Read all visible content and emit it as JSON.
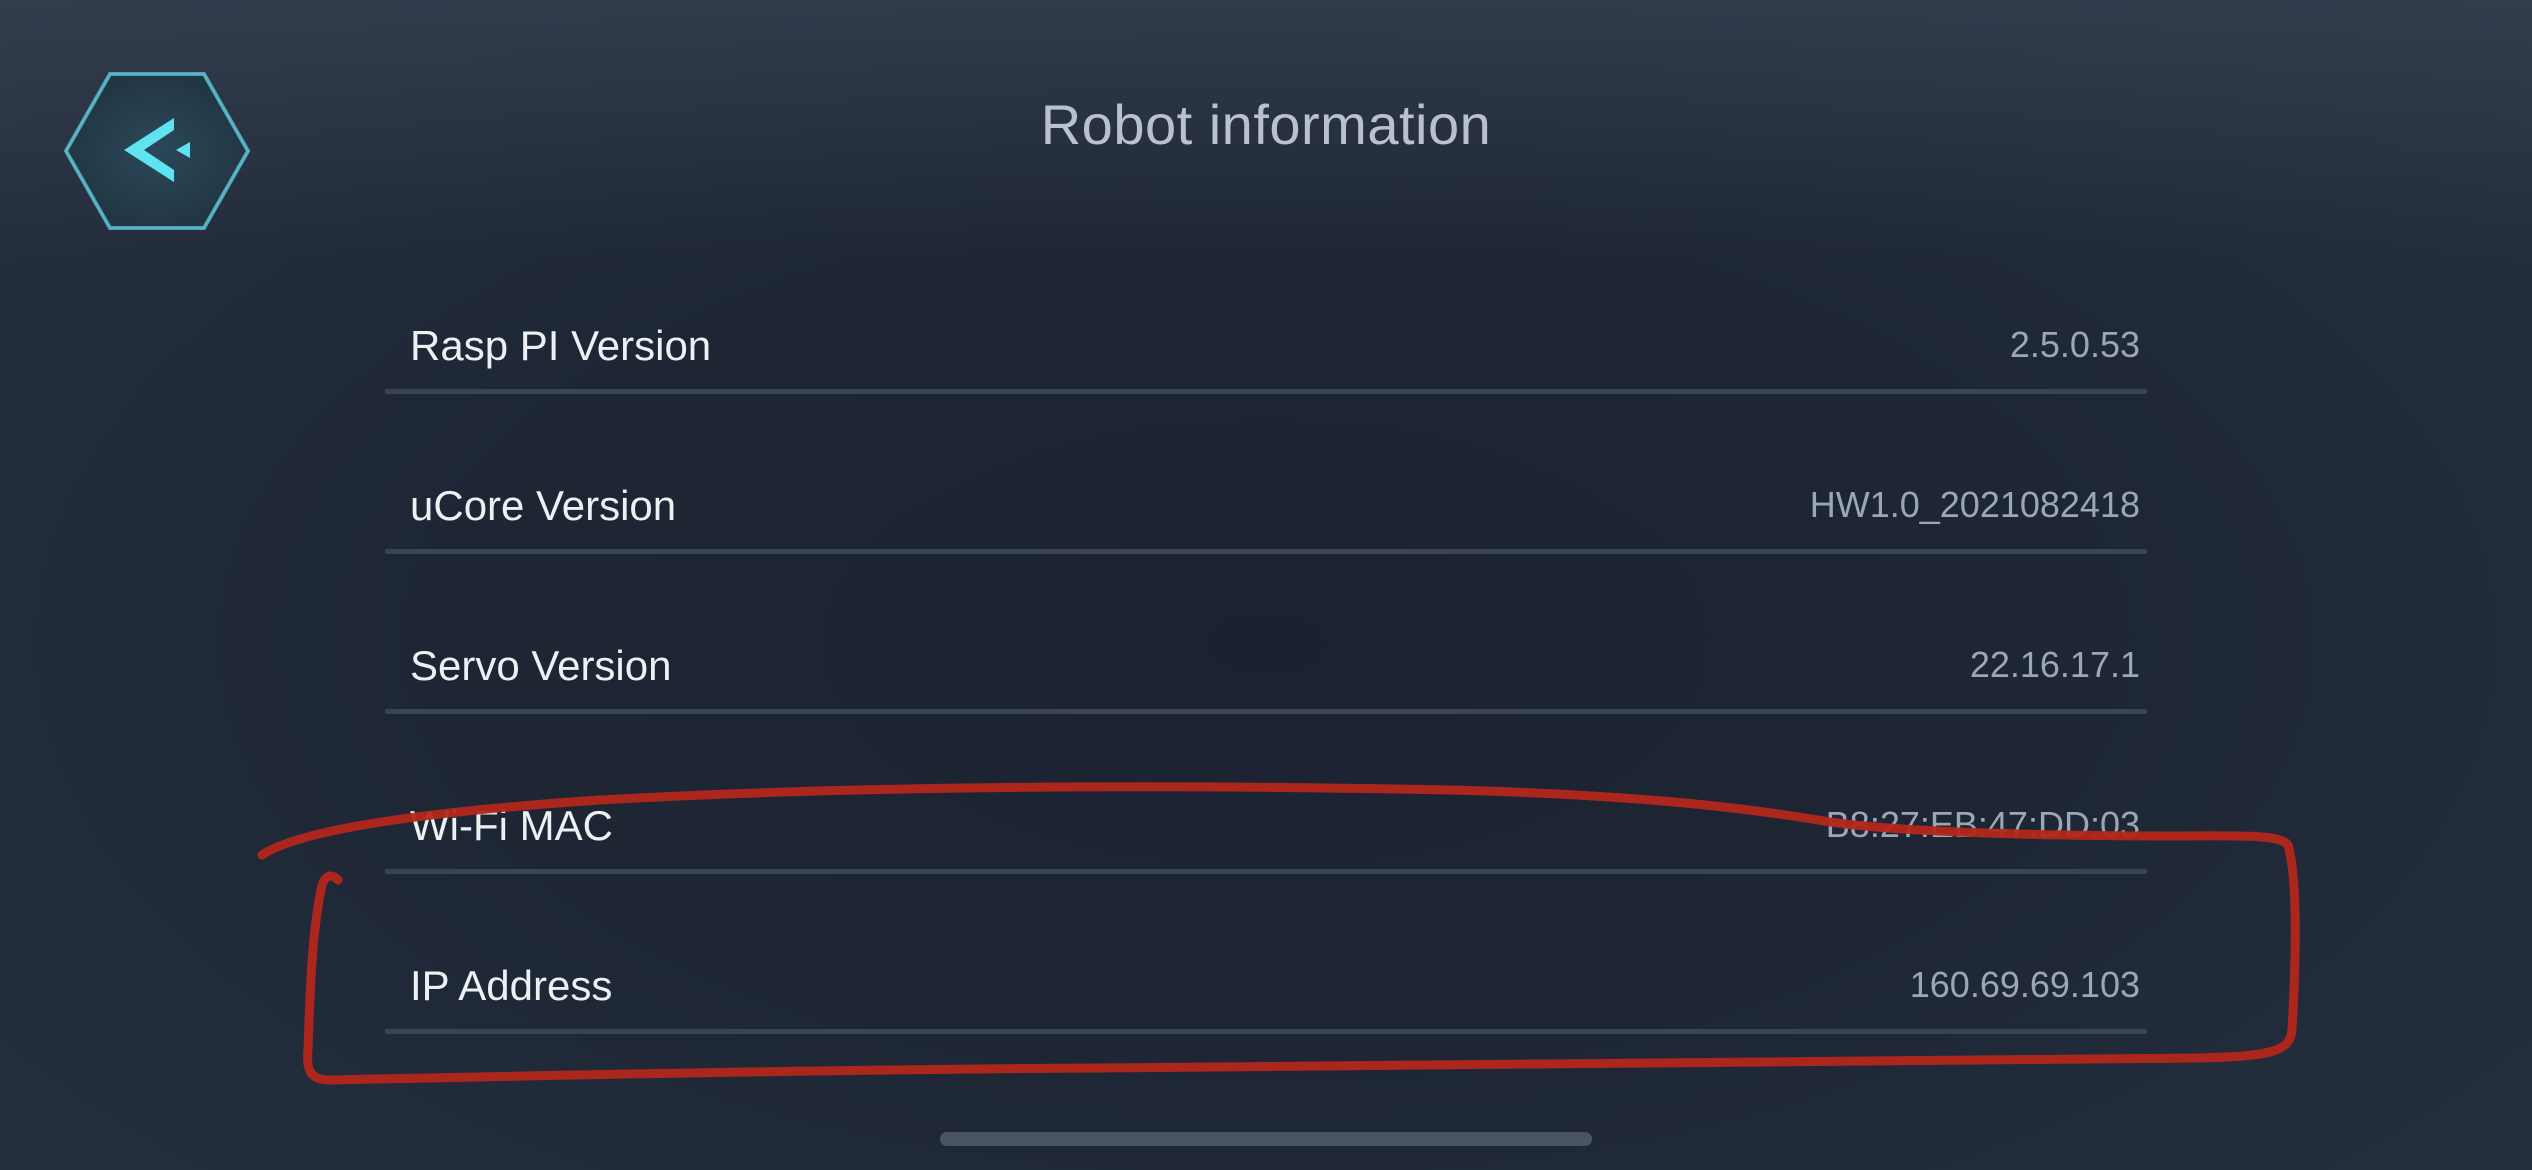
{
  "header": {
    "title": "Robot information",
    "back_icon": "back-arrow-hexagon-icon"
  },
  "info_rows": [
    {
      "label": "Rasp PI Version",
      "value": "2.5.0.53"
    },
    {
      "label": "uCore Version",
      "value": "HW1.0_2021082418"
    },
    {
      "label": "Servo Version",
      "value": "22.16.17.1"
    },
    {
      "label": "Wi-Fi MAC",
      "value": "B8:27:EB:47:DD:03"
    },
    {
      "label": "IP Address",
      "value": "160.69.69.103"
    }
  ],
  "annotation": {
    "type": "hand-drawn red outline",
    "color": "#b3271b"
  },
  "colors": {
    "accent": "#5fe3f0",
    "background": "#1e2634",
    "divider": "#3a4554"
  }
}
